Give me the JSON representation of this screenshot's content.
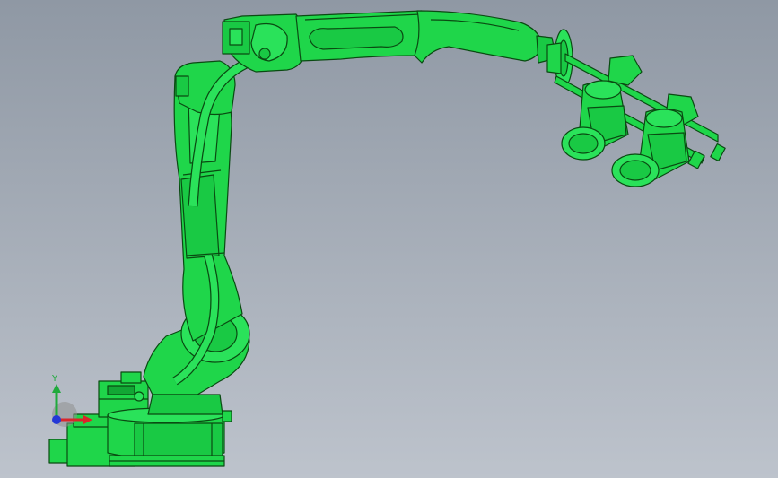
{
  "viewport": {
    "background_top": "#8f98a4",
    "background_bottom": "#bdc3cc"
  },
  "model": {
    "body_color": "#1fd64a",
    "edge_color": "#0a4a12",
    "highlight_color": "#6cf28a",
    "shade_color": "#12a634"
  },
  "triad": {
    "y_label": "Y",
    "x_color": "#d9262b",
    "y_color": "#1faa3c",
    "z_color": "#2438d6"
  }
}
